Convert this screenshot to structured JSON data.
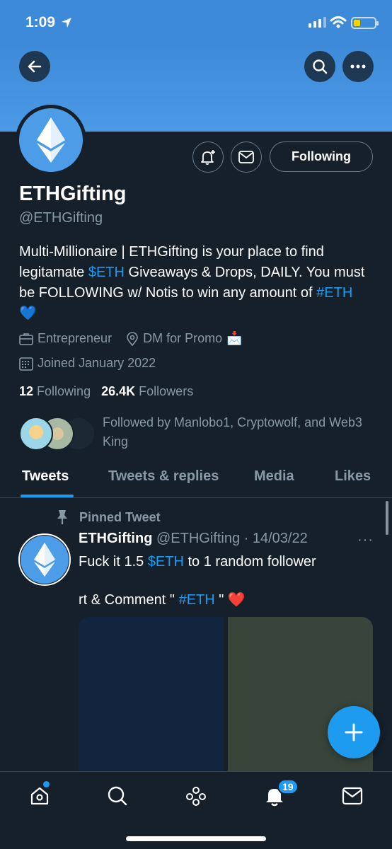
{
  "status_bar": {
    "time": "1:09"
  },
  "profile": {
    "name": "ETHGifting",
    "handle": "@ETHGifting",
    "bio_part1": "Multi-Millionaire | ETHGifting is your place to find legitamate ",
    "bio_link1": "$ETH",
    "bio_part2": " Giveaways & Drops, DAILY. You must be FOLLOWING w/ Notis to win any amount of ",
    "bio_link2": "#ETH",
    "bio_emoji": "💙",
    "category": "Entrepreneur",
    "location": "DM for Promo",
    "location_emoji": "📩",
    "joined": "Joined January 2022",
    "following_count": "12",
    "following_label": "Following",
    "followers_count": "26.4K",
    "followers_label": "Followers",
    "followed_by": "Followed by Manlobo1, Cryptowolf, and Web3 King",
    "follow_button": "Following"
  },
  "tabs": [
    "Tweets",
    "Tweets & replies",
    "Media",
    "Likes"
  ],
  "tweet": {
    "pinned_label": "Pinned Tweet",
    "author": "ETHGifting",
    "meta": " @ETHGifting · 14/03/22",
    "line1_before": "Fuck it 1.5 ",
    "line1_link": "$ETH",
    "line1_after": " to 1 random follower",
    "line2_before": "rt & Comment \" ",
    "line2_link": "#ETH",
    "line2_after": " \" ",
    "line2_emoji": "❤️",
    "more": "···"
  },
  "nav": {
    "notifications_badge": "19"
  },
  "colors": {
    "accent": "#1d9bf0",
    "background": "#15202b",
    "banner": "#4b9ae6"
  },
  "icons": [
    "back-arrow-icon",
    "search-icon",
    "more-icon",
    "notification-bell-plus-icon",
    "mail-icon",
    "briefcase-icon",
    "location-pin-icon",
    "calendar-icon",
    "pin-icon",
    "compose-plus-icon",
    "home-icon",
    "explore-icon",
    "spaces-icon",
    "bell-icon",
    "messages-icon"
  ]
}
